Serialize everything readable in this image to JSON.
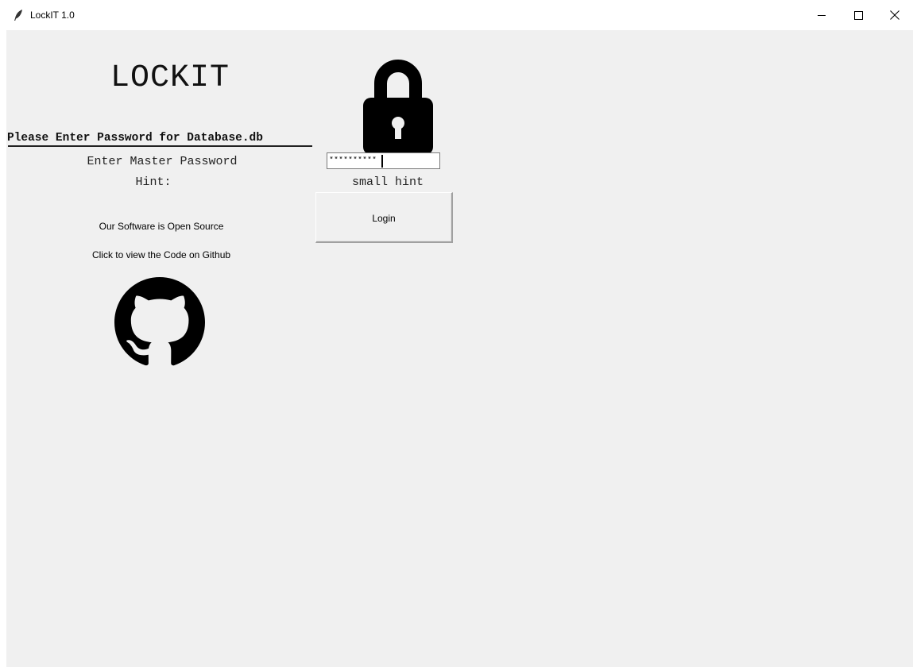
{
  "window": {
    "title": "LockIT 1.0",
    "controls": {
      "minimize_icon": "minimize-icon",
      "maximize_icon": "maximize-icon",
      "close_icon": "close-icon"
    }
  },
  "app": {
    "heading": "LOCKIT",
    "lock_icon": "padlock-icon",
    "database_prompt": "Please Enter Password for Database.db",
    "master_password_label": "Enter Master Password",
    "password_value": "**********",
    "hint_label": "Hint:",
    "hint_value": "small hint",
    "login_button": "Login",
    "open_source_text": "Our Software is Open Source",
    "github_link_text": "Click to view the Code on Github",
    "github_icon": "github-icon"
  },
  "colors": {
    "window_background": "#f0f0f0",
    "titlebar_background": "#ffffff",
    "icon_color": "#000000"
  }
}
